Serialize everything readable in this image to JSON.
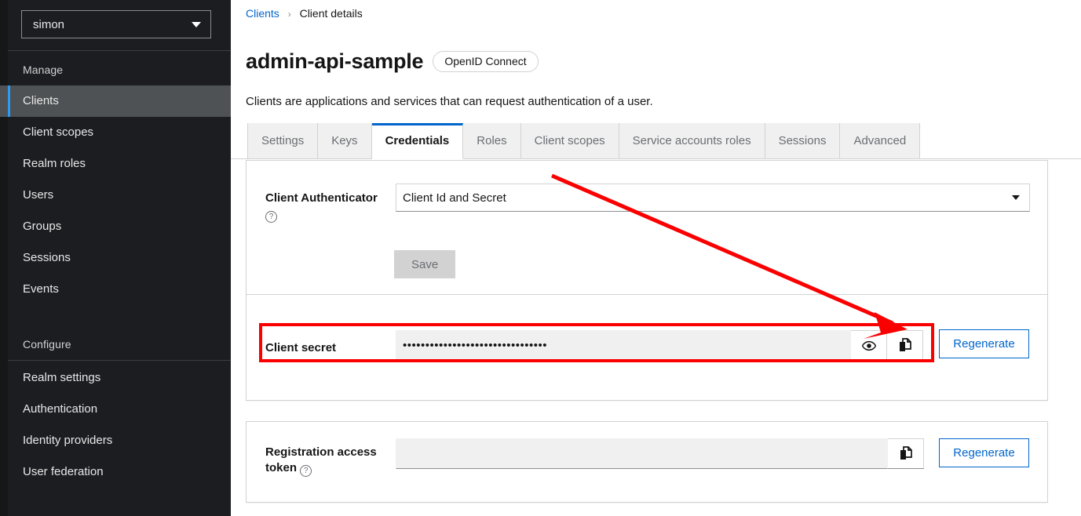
{
  "sidebar": {
    "realm_selector": {
      "value": "simon",
      "icon": "chevron-down-icon"
    },
    "sections": [
      {
        "title": "Manage",
        "items": [
          {
            "label": "Clients",
            "active": true
          },
          {
            "label": "Client scopes",
            "active": false
          },
          {
            "label": "Realm roles",
            "active": false
          },
          {
            "label": "Users",
            "active": false
          },
          {
            "label": "Groups",
            "active": false
          },
          {
            "label": "Sessions",
            "active": false
          },
          {
            "label": "Events",
            "active": false
          }
        ]
      },
      {
        "title": "Configure",
        "items": [
          {
            "label": "Realm settings",
            "active": false
          },
          {
            "label": "Authentication",
            "active": false
          },
          {
            "label": "Identity providers",
            "active": false
          },
          {
            "label": "User federation",
            "active": false
          }
        ]
      }
    ]
  },
  "breadcrumb": {
    "root": "Clients",
    "separator": "›",
    "current": "Client details"
  },
  "header": {
    "title": "admin-api-sample",
    "badge": "OpenID Connect",
    "description": "Clients are applications and services that can request authentication of a user."
  },
  "tabs": [
    {
      "label": "Settings",
      "active": false
    },
    {
      "label": "Keys",
      "active": false
    },
    {
      "label": "Credentials",
      "active": true
    },
    {
      "label": "Roles",
      "active": false
    },
    {
      "label": "Client scopes",
      "active": false
    },
    {
      "label": "Service accounts roles",
      "active": false
    },
    {
      "label": "Sessions",
      "active": false
    },
    {
      "label": "Advanced",
      "active": false
    }
  ],
  "credentials": {
    "authenticator": {
      "label": "Client Authenticator",
      "help_icon": "help-circle-icon",
      "value": "Client Id and Secret",
      "caret_icon": "chevron-down-icon"
    },
    "save_button": {
      "label": "Save",
      "disabled": true
    },
    "client_secret": {
      "label": "Client secret",
      "value": "••••••••••••••••••••••••••••••••",
      "reveal_icon": "eye-icon",
      "copy_icon": "copy-icon",
      "regenerate_label": "Regenerate"
    }
  },
  "registration_token": {
    "label_line1": "Registration access",
    "label_line2": "token",
    "help_icon": "help-circle-icon",
    "value": "",
    "copy_icon": "copy-icon",
    "regenerate_label": "Regenerate"
  },
  "annotations": {
    "highlight_color": "#fb0000",
    "arrow_from": "703,224",
    "arrow_to": "1150,418",
    "highlight_target": "client-secret-row"
  },
  "colors": {
    "accent": "#0066cc",
    "sidebar_bg": "#1b1d21",
    "active_nav": "#2b9af3",
    "annotation": "#fb0000"
  }
}
